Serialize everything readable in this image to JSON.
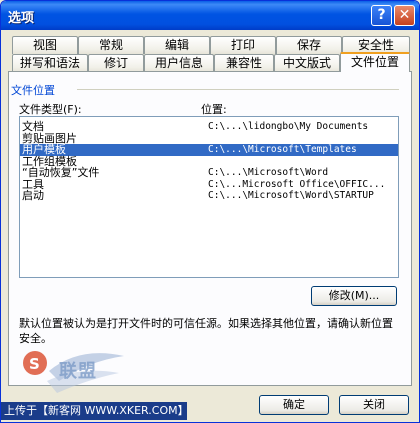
{
  "window": {
    "title": "选项"
  },
  "tabs_row1": [
    "视图",
    "常规",
    "编辑",
    "打印",
    "保存",
    "安全性"
  ],
  "tabs_row2": [
    "拼写和语法",
    "修订",
    "用户信息",
    "兼容性",
    "中文版式",
    "文件位置"
  ],
  "section": {
    "title": "文件位置"
  },
  "headers": {
    "file_type": "文件类型(F):",
    "location": "位置:"
  },
  "rows": [
    {
      "type": "文档",
      "location": "C:\\...\\lidongbo\\My Documents"
    },
    {
      "type": "剪贴画图片",
      "location": ""
    },
    {
      "type": "用户模板",
      "location": "C:\\...\\Microsoft\\Templates"
    },
    {
      "type": "工作组模板",
      "location": ""
    },
    {
      "type": "“自动恢复”文件",
      "location": "C:\\...\\Microsoft\\Word"
    },
    {
      "type": "工具",
      "location": "C:\\...Microsoft Office\\OFFIC..."
    },
    {
      "type": "启动",
      "location": "C:\\...\\Microsoft\\Word\\STARTUP"
    }
  ],
  "selected_row": 2,
  "buttons": {
    "modify": "修改(M)...",
    "ok": "确定",
    "close": "关闭"
  },
  "note": "默认位置被认为是打开文件时的可信任源。如果选择其他位置，请确认新位置安全。",
  "watermark": {
    "text": "联盟",
    "uploader": "上传于【新客网 WWW.XKER.COM】"
  },
  "colors": {
    "title_bar": "#0054e3",
    "selection": "#316ac5",
    "section_title": "#0046d5"
  }
}
